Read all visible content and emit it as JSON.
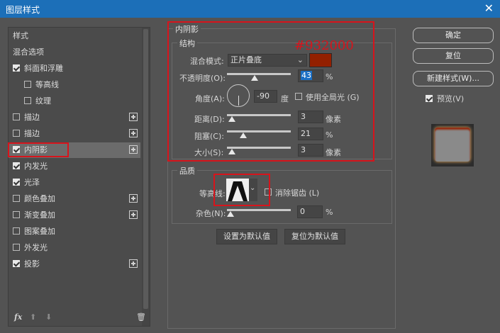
{
  "window": {
    "title": "图层样式",
    "close_label": "✕"
  },
  "left_panel": {
    "items": [
      {
        "label": "样式",
        "checkbox": false,
        "checked": false,
        "indent": false,
        "plus": false,
        "selected": false
      },
      {
        "label": "混合选项",
        "checkbox": false,
        "checked": false,
        "indent": false,
        "plus": false,
        "selected": false
      },
      {
        "label": "斜面和浮雕",
        "checkbox": true,
        "checked": true,
        "indent": false,
        "plus": false,
        "selected": false
      },
      {
        "label": "等高线",
        "checkbox": true,
        "checked": false,
        "indent": true,
        "plus": false,
        "selected": false
      },
      {
        "label": "纹理",
        "checkbox": true,
        "checked": false,
        "indent": true,
        "plus": false,
        "selected": false
      },
      {
        "label": "描边",
        "checkbox": true,
        "checked": false,
        "indent": false,
        "plus": true,
        "selected": false
      },
      {
        "label": "描边",
        "checkbox": true,
        "checked": false,
        "indent": false,
        "plus": true,
        "selected": false
      },
      {
        "label": "内阴影",
        "checkbox": true,
        "checked": true,
        "indent": false,
        "plus": true,
        "selected": true
      },
      {
        "label": "内发光",
        "checkbox": true,
        "checked": true,
        "indent": false,
        "plus": false,
        "selected": false
      },
      {
        "label": "光泽",
        "checkbox": true,
        "checked": true,
        "indent": false,
        "plus": false,
        "selected": false
      },
      {
        "label": "颜色叠加",
        "checkbox": true,
        "checked": false,
        "indent": false,
        "plus": true,
        "selected": false
      },
      {
        "label": "渐变叠加",
        "checkbox": true,
        "checked": false,
        "indent": false,
        "plus": true,
        "selected": false
      },
      {
        "label": "图案叠加",
        "checkbox": true,
        "checked": false,
        "indent": false,
        "plus": false,
        "selected": false
      },
      {
        "label": "外发光",
        "checkbox": true,
        "checked": false,
        "indent": false,
        "plus": false,
        "selected": false
      },
      {
        "label": "投影",
        "checkbox": true,
        "checked": true,
        "indent": false,
        "plus": true,
        "selected": false
      }
    ],
    "footer": {
      "fx": "fx",
      "up": "⬆",
      "down": "⬇",
      "trash": "🗑"
    }
  },
  "inner_shadow": {
    "title": "内阴影",
    "structure": {
      "title": "结构",
      "blend_mode_label": "混合模式:",
      "blend_mode_value": "正片叠底",
      "color_hex": "#932000",
      "opacity_label": "不透明度(O):",
      "opacity_value": "43",
      "opacity_unit": "%",
      "opacity_fraction": 0.43,
      "angle_label": "角度(A):",
      "angle_value": "-90",
      "angle_unit": "度",
      "global_light_label": "使用全局光 (G)",
      "distance_label": "距离(D):",
      "distance_value": "3",
      "distance_unit": "像素",
      "choke_label": "阻塞(C):",
      "choke_value": "21",
      "choke_unit": "%",
      "size_label": "大小(S):",
      "size_value": "3",
      "size_unit": "像素"
    },
    "quality": {
      "title": "品质",
      "contour_label": "等高线:",
      "antialias_label": "消除锯齿 (L)",
      "noise_label": "杂色(N):",
      "noise_value": "0",
      "noise_unit": "%"
    },
    "set_default_label": "设置为默认值",
    "reset_default_label": "复位为默认值"
  },
  "right_panel": {
    "ok_label": "确定",
    "reset_label": "复位",
    "new_style_label": "新建样式(W)...",
    "preview_label": "预览(V)"
  },
  "annotation": {
    "color_text": "#932000",
    "accent_color": "#d7141c"
  }
}
